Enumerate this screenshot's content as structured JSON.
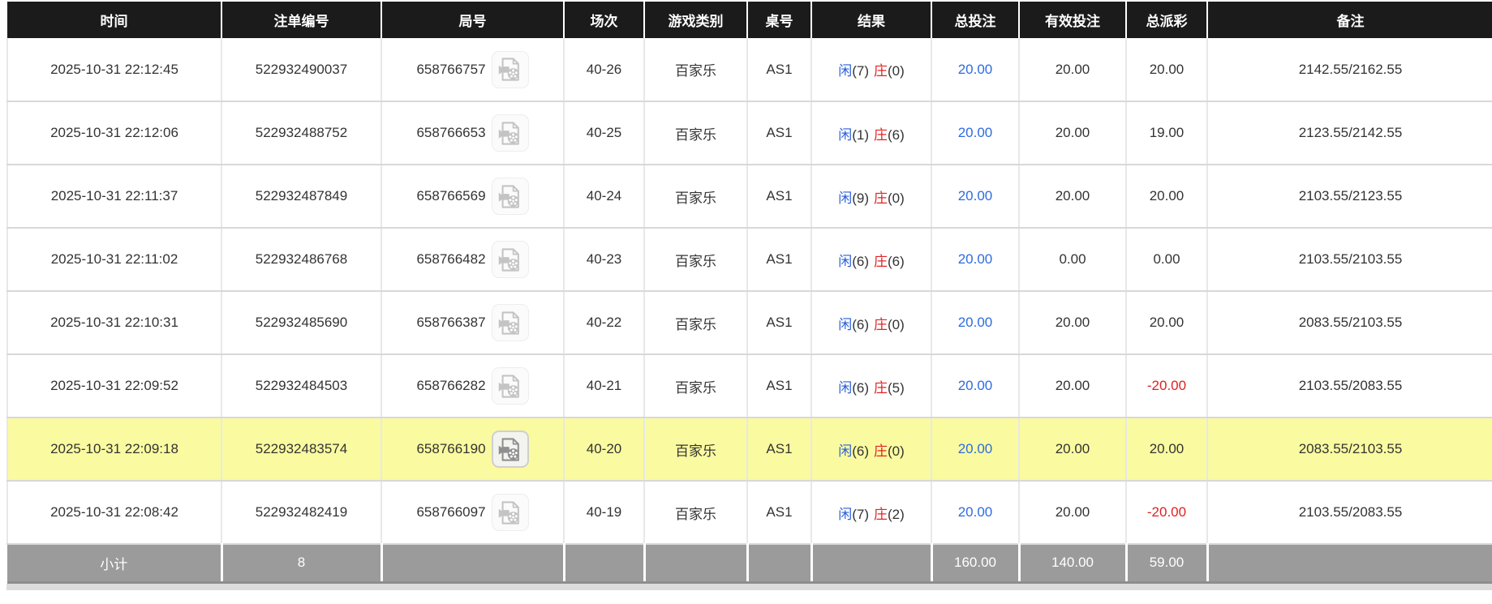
{
  "columns": [
    "时间",
    "注单编号",
    "局号",
    "场次",
    "游戏类别",
    "桌号",
    "结果",
    "总投注",
    "有效投注",
    "总派彩",
    "备注"
  ],
  "labels": {
    "player": "闲",
    "banker": "庄"
  },
  "icons": {
    "video": "video-replay-icon"
  },
  "colors": {
    "header_bg": "#1b1b1b",
    "highlight_row": "#fafaa0",
    "subtotal_bg": "#9b9b9b",
    "player_blue": "#2c5fd6",
    "banker_red": "#e02424",
    "bet_blue": "#2e6be0",
    "negative_red": "#e02020"
  },
  "rows": [
    {
      "time": "2025-10-31 22:12:45",
      "bet_no": "522932490037",
      "round_no": "658766757",
      "session": "40-26",
      "game": "百家乐",
      "table": "AS1",
      "result_player": "(7)",
      "result_banker": "(0)",
      "total_bet": "20.00",
      "valid_bet": "20.00",
      "payout": "20.00",
      "remark": "2142.55/2162.55",
      "highlighted": false
    },
    {
      "time": "2025-10-31 22:12:06",
      "bet_no": "522932488752",
      "round_no": "658766653",
      "session": "40-25",
      "game": "百家乐",
      "table": "AS1",
      "result_player": "(1)",
      "result_banker": "(6)",
      "total_bet": "20.00",
      "valid_bet": "20.00",
      "payout": "19.00",
      "remark": "2123.55/2142.55",
      "highlighted": false
    },
    {
      "time": "2025-10-31 22:11:37",
      "bet_no": "522932487849",
      "round_no": "658766569",
      "session": "40-24",
      "game": "百家乐",
      "table": "AS1",
      "result_player": "(9)",
      "result_banker": "(0)",
      "total_bet": "20.00",
      "valid_bet": "20.00",
      "payout": "20.00",
      "remark": "2103.55/2123.55",
      "highlighted": false
    },
    {
      "time": "2025-10-31 22:11:02",
      "bet_no": "522932486768",
      "round_no": "658766482",
      "session": "40-23",
      "game": "百家乐",
      "table": "AS1",
      "result_player": "(6)",
      "result_banker": "(6)",
      "total_bet": "20.00",
      "valid_bet": "0.00",
      "payout": "0.00",
      "remark": "2103.55/2103.55",
      "highlighted": false
    },
    {
      "time": "2025-10-31 22:10:31",
      "bet_no": "522932485690",
      "round_no": "658766387",
      "session": "40-22",
      "game": "百家乐",
      "table": "AS1",
      "result_player": "(6)",
      "result_banker": "(0)",
      "total_bet": "20.00",
      "valid_bet": "20.00",
      "payout": "20.00",
      "remark": "2083.55/2103.55",
      "highlighted": false
    },
    {
      "time": "2025-10-31 22:09:52",
      "bet_no": "522932484503",
      "round_no": "658766282",
      "session": "40-21",
      "game": "百家乐",
      "table": "AS1",
      "result_player": "(6)",
      "result_banker": "(5)",
      "total_bet": "20.00",
      "valid_bet": "20.00",
      "payout": "-20.00",
      "remark": "2103.55/2083.55",
      "highlighted": false
    },
    {
      "time": "2025-10-31 22:09:18",
      "bet_no": "522932483574",
      "round_no": "658766190",
      "session": "40-20",
      "game": "百家乐",
      "table": "AS1",
      "result_player": "(6)",
      "result_banker": "(0)",
      "total_bet": "20.00",
      "valid_bet": "20.00",
      "payout": "20.00",
      "remark": "2083.55/2103.55",
      "highlighted": true
    },
    {
      "time": "2025-10-31 22:08:42",
      "bet_no": "522932482419",
      "round_no": "658766097",
      "session": "40-19",
      "game": "百家乐",
      "table": "AS1",
      "result_player": "(7)",
      "result_banker": "(2)",
      "total_bet": "20.00",
      "valid_bet": "20.00",
      "payout": "-20.00",
      "remark": "2103.55/2083.55",
      "highlighted": false
    }
  ],
  "subtotal": {
    "label": "小计",
    "count": "8",
    "total_bet": "160.00",
    "valid_bet": "140.00",
    "total_payout": "59.00"
  }
}
